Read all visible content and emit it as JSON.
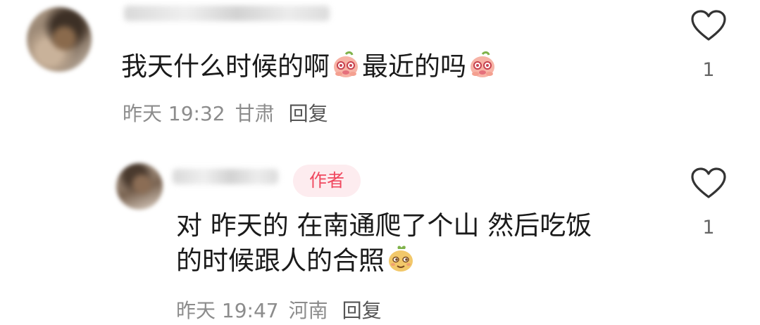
{
  "comments": [
    {
      "text_line1_a": "我天什么时候的啊",
      "text_line1_b": "最近的吗",
      "emoji_1": "crying-peach-emoji",
      "emoji_2": "crying-peach-emoji",
      "time": "昨天 19:32",
      "location": "甘肃",
      "reply_label": "回复",
      "like_count": "1"
    },
    {
      "badge": "作者",
      "text_line1": "对 昨天的 在南通爬了个山 然后吃饭",
      "text_line2": "的时候跟人的合照",
      "emoji": "smug-fruit-emoji",
      "time": "昨天 19:47",
      "location": "河南",
      "reply_label": "回复",
      "like_count": "1"
    }
  ],
  "colors": {
    "badge_text": "#f0485f",
    "badge_bg": "#fdecef",
    "meta_text": "#8c8c8c",
    "heart_outline": "#333333"
  }
}
